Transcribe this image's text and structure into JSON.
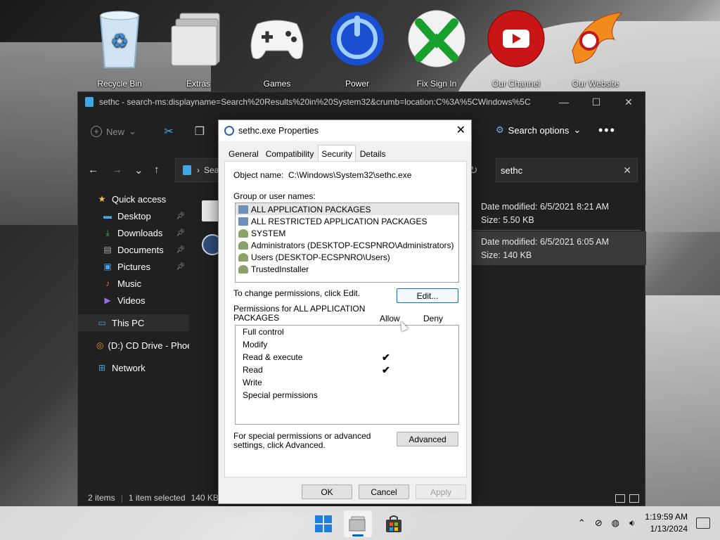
{
  "desktop": {
    "icons": [
      {
        "label": "Recycle Bin",
        "icon": "recycle-bin-icon"
      },
      {
        "label": "Extras",
        "icon": "folder-stack-icon"
      },
      {
        "label": "Games",
        "icon": "gamepad-icon"
      },
      {
        "label": "Power",
        "icon": "power-icon"
      },
      {
        "label": "Fix Sign In",
        "icon": "xbox-icon"
      },
      {
        "label": "Our Channel",
        "icon": "youtube-icon"
      },
      {
        "label": "Our Website",
        "icon": "phoenix-logo-icon"
      }
    ]
  },
  "explorer": {
    "title": "sethc - search-ms:displayname=Search%20Results%20in%20System32&crumb=location:C%3A%5CWindows%5C",
    "toolbar": {
      "new_label": "New",
      "search_options_label": "Search options",
      "more_label": "•••"
    },
    "address_prefix": "Sea",
    "search_value": "sethc",
    "sidebar": [
      {
        "label": "Quick access",
        "icon": "star-icon",
        "pinned": false
      },
      {
        "label": "Desktop",
        "icon": "desktop-icon",
        "pinned": true
      },
      {
        "label": "Downloads",
        "icon": "download-icon",
        "pinned": true
      },
      {
        "label": "Documents",
        "icon": "documents-icon",
        "pinned": true
      },
      {
        "label": "Pictures",
        "icon": "pictures-icon",
        "pinned": true
      },
      {
        "label": "Music",
        "icon": "music-icon",
        "pinned": false
      },
      {
        "label": "Videos",
        "icon": "videos-icon",
        "pinned": false
      },
      {
        "label": "This PC",
        "icon": "computer-icon",
        "pinned": false
      },
      {
        "label": "(D:) CD Drive - Phoe",
        "icon": "cd-drive-icon",
        "pinned": false
      },
      {
        "label": "Network",
        "icon": "network-icon",
        "pinned": false
      }
    ],
    "results": [
      {
        "modified": "Date modified: 6/5/2021 8:21 AM",
        "size": "Size: 5.50 KB"
      },
      {
        "modified": "Date modified: 6/5/2021 6:05 AM",
        "size": "Size: 140 KB"
      }
    ],
    "status": {
      "items": "2 items",
      "selected": "1 item selected",
      "size": "140 KB"
    }
  },
  "dialog": {
    "title": "sethc.exe Properties",
    "tabs": [
      "General",
      "Compatibility",
      "Security",
      "Details"
    ],
    "active_tab": "Security",
    "object_name_label": "Object name:",
    "object_name_value": "C:\\Windows\\System32\\sethc.exe",
    "group_label": "Group or user names:",
    "users": [
      "ALL APPLICATION PACKAGES",
      "ALL RESTRICTED APPLICATION PACKAGES",
      "SYSTEM",
      "Administrators (DESKTOP-ECSPNRO\\Administrators)",
      "Users (DESKTOP-ECSPNRO\\Users)",
      "TrustedInstaller"
    ],
    "change_text": "To change permissions, click Edit.",
    "edit_label": "Edit...",
    "perm_label": "Permissions for ALL APPLICATION PACKAGES",
    "allow_label": "Allow",
    "deny_label": "Deny",
    "permissions": [
      {
        "name": "Full control",
        "allow": ""
      },
      {
        "name": "Modify",
        "allow": ""
      },
      {
        "name": "Read & execute",
        "allow": "✔"
      },
      {
        "name": "Read",
        "allow": "✔"
      },
      {
        "name": "Write",
        "allow": ""
      },
      {
        "name": "Special permissions",
        "allow": ""
      }
    ],
    "advanced_text": "For special permissions or advanced settings, click Advanced.",
    "advanced_label": "Advanced",
    "ok_label": "OK",
    "cancel_label": "Cancel",
    "apply_label": "Apply"
  },
  "taskbar": {
    "time": "1:19:59 AM",
    "date": "1/13/2024"
  }
}
